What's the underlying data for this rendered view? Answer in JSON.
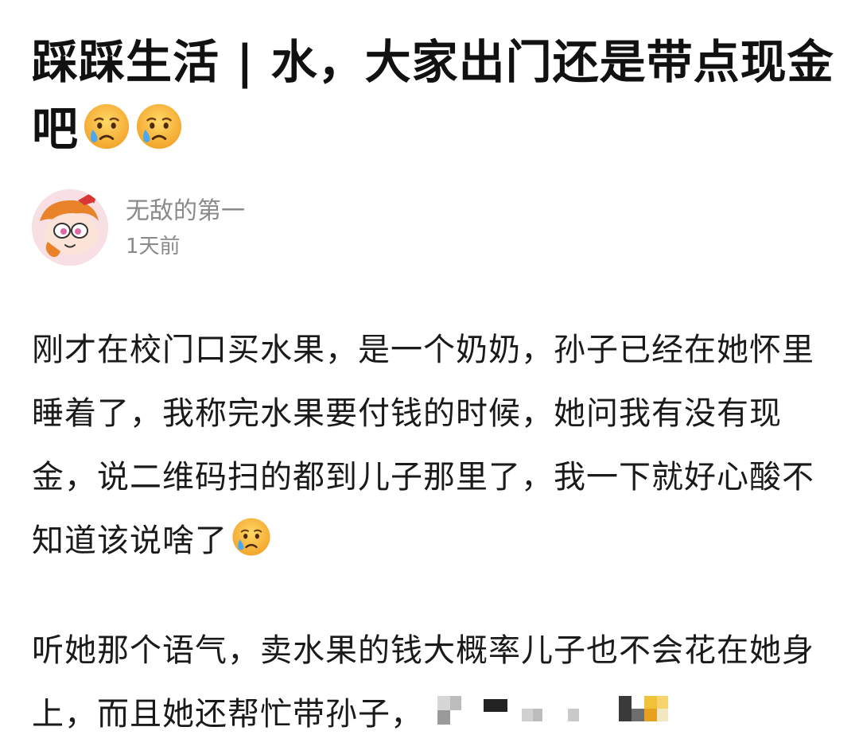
{
  "post": {
    "title": "踩踩生活 | 水，大家出门还是带点现金吧",
    "title_emojis": [
      "crying-face",
      "crying-face"
    ]
  },
  "author": {
    "name": "无敌的第一",
    "time": "1天前",
    "avatar_icon": "cartoon-girl-avatar"
  },
  "body": {
    "paragraph_1": "刚才在校门口买水果，是一个奶奶，孙子已经在她怀里睡着了，我称完水果要付钱的时候，她问我有没有现金，说二维码扫的都到儿子那里了，我一下就好心酸不知道该说啥了",
    "paragraph_1_emoji": "crying-face",
    "paragraph_2": "听她那个语气，卖水果的钱大概率儿子也不会花在她身上，而且她还帮忙带孙子，",
    "paragraph_2_redacted": "pixelated-censored-text"
  },
  "colors": {
    "text": "#1a1a1a",
    "meta": "#8a8a8a",
    "emoji_face": "#f6b73c",
    "emoji_tear": "#4aa8f0"
  }
}
